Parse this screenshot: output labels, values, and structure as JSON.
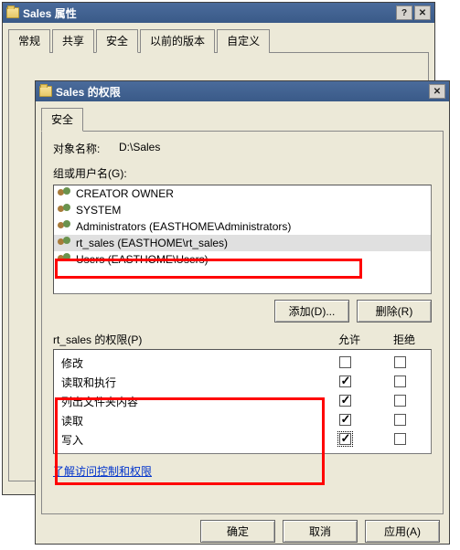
{
  "windows": {
    "back": {
      "title": "Sales 属性",
      "tabs": [
        "常规",
        "共享",
        "安全",
        "以前的版本",
        "自定义"
      ],
      "activeTab": 2
    },
    "front": {
      "title": "Sales 的权限",
      "tabs": [
        "安全"
      ],
      "activeTab": 0,
      "objectNameLabel": "对象名称:",
      "objectNameValue": "D:\\Sales",
      "groupsLabel": "组或用户名(G):",
      "groups": [
        "CREATOR OWNER",
        "SYSTEM",
        "Administrators (EASTHOME\\Administrators)",
        "rt_sales (EASTHOME\\rt_sales)",
        "Users (EASTHOME\\Users)"
      ],
      "selectedGroupIndex": 3,
      "addBtn": "添加(D)...",
      "removeBtn": "删除(R)",
      "permForLabel": "rt_sales 的权限(P)",
      "allowLabel": "允许",
      "denyLabel": "拒绝",
      "permissions": [
        {
          "name": "修改",
          "allow": false,
          "deny": false
        },
        {
          "name": "读取和执行",
          "allow": true,
          "deny": false
        },
        {
          "name": "列出文件夹内容",
          "allow": true,
          "deny": false
        },
        {
          "name": "读取",
          "allow": true,
          "deny": false
        },
        {
          "name": "写入",
          "allow": true,
          "deny": false,
          "focus": true
        }
      ],
      "link": "了解访问控制和权限",
      "okBtn": "确定",
      "cancelBtn": "取消",
      "applyBtn": "应用(A)"
    }
  }
}
